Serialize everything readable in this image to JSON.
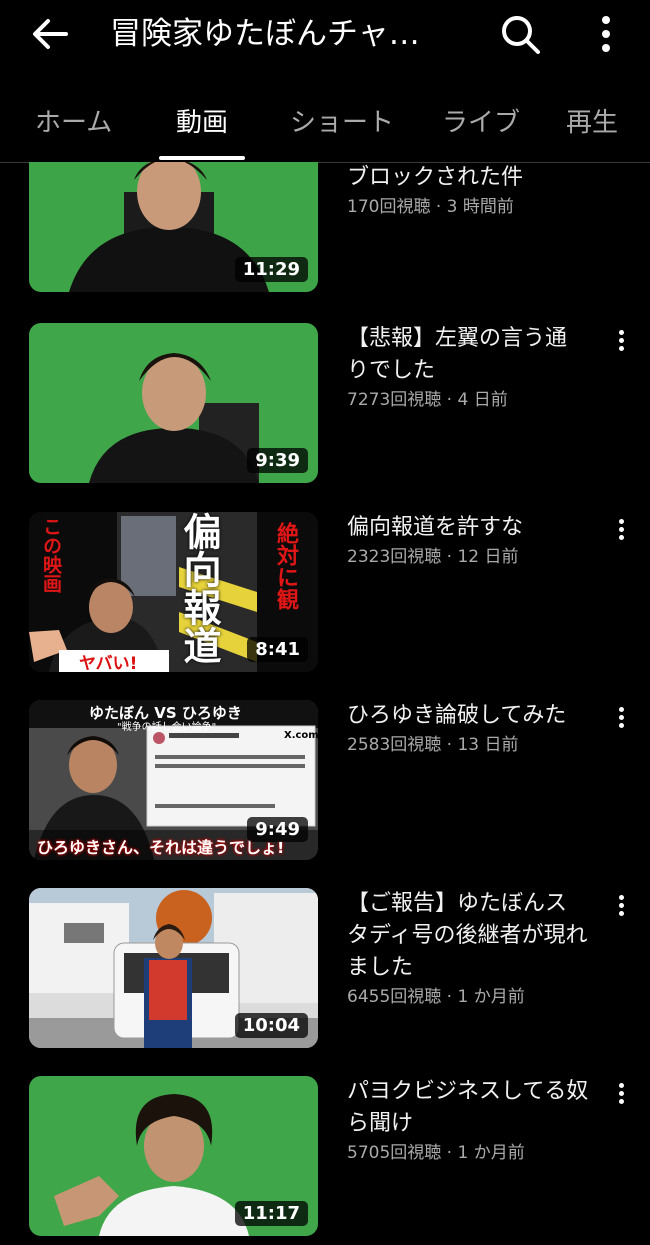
{
  "header": {
    "channel_title": "冒険家ゆたぼんチャ…",
    "back_icon": "arrow-left-icon",
    "search_icon": "search-icon",
    "more_icon": "more-vert-icon"
  },
  "tabs": [
    {
      "label": "ホーム"
    },
    {
      "label": "動画"
    },
    {
      "label": "ショート"
    },
    {
      "label": "ライブ"
    },
    {
      "label": "再生"
    }
  ],
  "active_tab": "動画",
  "videos": [
    {
      "title_lines": [
        "ブロックされた件"
      ],
      "stats": "170回視聴 · 3 時間前",
      "duration": "11:29"
    },
    {
      "title_lines": [
        "【悲報】左翼の言う通",
        "りでした"
      ],
      "stats": "7273回視聴 · 4 日前",
      "duration": "9:39"
    },
    {
      "title_lines": [
        "偏向報道を許すな"
      ],
      "stats": "2323回視聴 · 12 日前",
      "duration": "8:41",
      "thumb_text": {
        "main": "偏向報道",
        "left": "この映画",
        "right": "絶対に観",
        "bottom": "ヤバい!"
      }
    },
    {
      "title_lines": [
        "ひろゆき論破してみた"
      ],
      "stats": "2583回視聴 · 13 日前",
      "duration": "9:49",
      "thumb_text": {
        "top": "ゆたぼん VS ひろゆき",
        "sub": "\"戦争の話し合い論争\"",
        "bottom": "ひろゆきさん、それは違うでしょ!",
        "brand": "X.com"
      }
    },
    {
      "title_lines": [
        "【ご報告】ゆたぼんス",
        "タディ号の後継者が現れ",
        "ました"
      ],
      "stats": "6455回視聴 · 1 か月前",
      "duration": "10:04"
    },
    {
      "title_lines": [
        "パヨクビジネスしてる奴",
        "ら聞け"
      ],
      "stats": "5705回視聴 · 1 か月前",
      "duration": "11:17"
    }
  ],
  "colors": {
    "background": "#000000",
    "text": "#f1f1f1",
    "subtext": "#aaaaaa",
    "greenscreen": "#3fa34a"
  }
}
